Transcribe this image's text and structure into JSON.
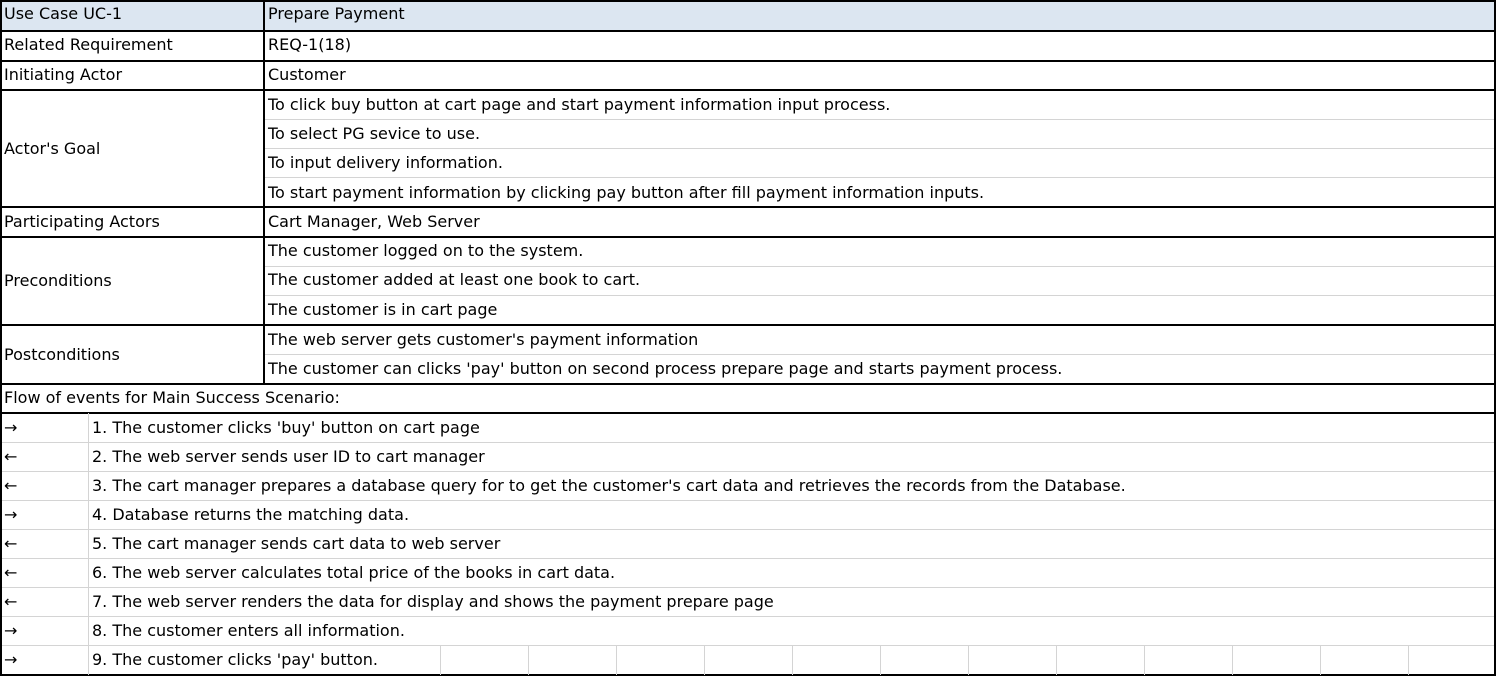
{
  "use_case": {
    "id_label": "Use Case UC-1",
    "name": "Prepare Payment"
  },
  "related_requirement": {
    "label": "Related Requirement",
    "value": "REQ-1(18)"
  },
  "initiating_actor": {
    "label": "Initiating Actor",
    "value": "Customer"
  },
  "actors_goal": {
    "label": "Actor's Goal",
    "items": [
      "To click buy button at cart page and start payment information input process.",
      "To select PG sevice to use.",
      "To input delivery information.",
      "To start payment information by clicking pay button after fill payment information inputs."
    ]
  },
  "participating_actors": {
    "label": "Participating Actors",
    "value": "Cart Manager, Web Server"
  },
  "preconditions": {
    "label": "Preconditions",
    "items": [
      "The customer logged on to the system.",
      "The customer added at least one book to cart.",
      "The customer is in cart page"
    ]
  },
  "postconditions": {
    "label": "Postconditions",
    "items": [
      "The web server gets customer's payment information",
      "The customer can clicks 'pay' button on second process prepare page and starts payment process."
    ]
  },
  "flow": {
    "label": "Flow of events for Main Success Scenario:",
    "steps": [
      {
        "arrow": "→",
        "text": "1. The customer clicks 'buy' button on cart page"
      },
      {
        "arrow": "←",
        "text": "2. The web server sends user ID to cart manager"
      },
      {
        "arrow": "←",
        "text": "3. The cart manager prepares a database query for to get the customer's cart data and retrieves the records from the Database."
      },
      {
        "arrow": "→",
        "text": "4. Database returns the matching data."
      },
      {
        "arrow": "←",
        "text": "5. The cart manager sends cart data to web server"
      },
      {
        "arrow": "←",
        "text": "6. The web server calculates total price of the books in cart data."
      },
      {
        "arrow": "←",
        "text": "7. The web server renders the data for display and shows the payment prepare page"
      },
      {
        "arrow": "→",
        "text": "8. The customer enters all information."
      },
      {
        "arrow": "→",
        "text": "9. The customer clicks 'pay' button."
      }
    ]
  }
}
